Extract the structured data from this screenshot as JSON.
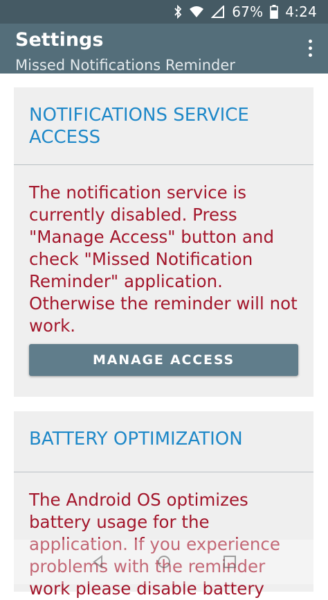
{
  "status_bar": {
    "battery_percent": "67%",
    "time": "4:24",
    "icons": [
      "bluetooth-icon",
      "wifi-icon",
      "signal-icon",
      "battery-icon"
    ]
  },
  "app_bar": {
    "title": "Settings",
    "subtitle": "Missed Notifications Reminder",
    "menu_icon": "more-vert-icon"
  },
  "notification_card": {
    "header": "NOTIFICATIONS SERVICE ACCESS",
    "message": "The notification service is currently disabled. Press \"Manage Access\" button and check \"Missed Notification Reminder\" application. Otherwise the reminder will not work.",
    "button_label": "MANAGE ACCESS"
  },
  "battery_card": {
    "header": "BATTERY OPTIMIZATION",
    "message": "The Android OS optimizes battery usage for the application. If you experience problems with the reminder work please disable battery"
  },
  "nav_bar": {
    "icons": [
      "back-icon",
      "home-icon",
      "recents-icon"
    ]
  },
  "colors": {
    "status_bar": "#455a64",
    "app_bar": "#546e7a",
    "header_text": "#1e88c8",
    "warning_text": "#a3162b",
    "button": "#607d8b",
    "card_bg": "#efefef"
  }
}
